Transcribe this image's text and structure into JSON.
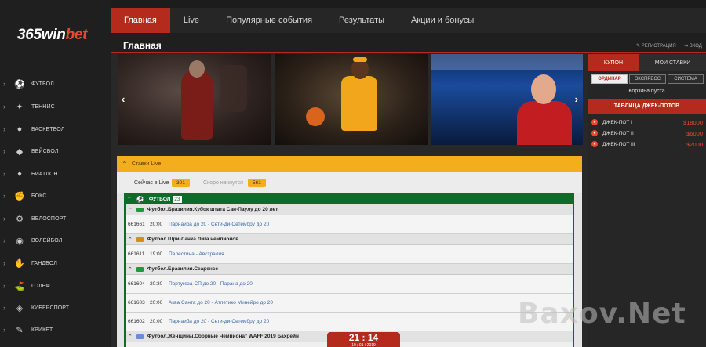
{
  "brand": {
    "logo_main": "365win",
    "logo_accent": "bet"
  },
  "topnav": [
    {
      "label": "Главная",
      "active": true
    },
    {
      "label": "Live",
      "active": false
    },
    {
      "label": "Популярные события",
      "active": false
    },
    {
      "label": "Результаты",
      "active": false
    },
    {
      "label": "Акции и бонусы",
      "active": false
    }
  ],
  "header": {
    "title": "Главная",
    "register": "РЕГИСТРАЦИЯ",
    "login": "ВХОД"
  },
  "sidebar": {
    "items": [
      {
        "label": "ФУТБОЛ",
        "icon": "football-icon"
      },
      {
        "label": "ТЕННИС",
        "icon": "tennis-icon"
      },
      {
        "label": "БАСКЕТБОЛ",
        "icon": "basketball-icon"
      },
      {
        "label": "БЕЙСБОЛ",
        "icon": "baseball-icon"
      },
      {
        "label": "БИАТЛОН",
        "icon": "biathlon-icon"
      },
      {
        "label": "БОКС",
        "icon": "boxing-icon"
      },
      {
        "label": "ВЕЛОСПОРТ",
        "icon": "cycling-icon"
      },
      {
        "label": "ВОЛЕЙБОЛ",
        "icon": "volleyball-icon"
      },
      {
        "label": "ГАНДБОЛ",
        "icon": "handball-icon"
      },
      {
        "label": "ГОЛЬФ",
        "icon": "golf-icon"
      },
      {
        "label": "КИБЕРСПОРТ",
        "icon": "esports-icon"
      },
      {
        "label": "КРИКЕТ",
        "icon": "cricket-icon"
      }
    ]
  },
  "live": {
    "title": "Ставки Live",
    "now_label": "Сейчас в Live",
    "now_count": "301",
    "soon_label": "Скоро начнутся",
    "soon_count": "561",
    "sport": {
      "name": "ФУТБОЛ",
      "count": "23"
    },
    "leagues": [
      {
        "name": "Футбол.Бразилия.Кубок штата Сан-Паулу до 20 лет",
        "flag": "brazil",
        "events": [
          {
            "id": "661661",
            "time": "20:00",
            "teams": "Парнаиба до 20 - Сети-ди-Сетембру до 20"
          }
        ]
      },
      {
        "name": "Футбол.Шри-Ланка.Лига чемпионов",
        "flag": "sri-lanka",
        "events": [
          {
            "id": "661611",
            "time": "19:00",
            "teams": "Палестина - Австралия"
          }
        ]
      },
      {
        "name": "Футбол.Бразилия.Сеаренсе",
        "flag": "brazil",
        "events": [
          {
            "id": "661604",
            "time": "20:30",
            "teams": "Португеза-СП до 20 - Парана до 20"
          },
          {
            "id": "661603",
            "time": "20:00",
            "teams": "Аква Санта до 20 - Атлетико Минейро до 20"
          },
          {
            "id": "661602",
            "time": "20:00",
            "teams": "Парнаиба до 20 - Сети-ди-Сетембру до 20"
          }
        ]
      },
      {
        "name": "Футбол.Женщины.Сборные Чемпионат WAFF 2019 Бахрейн",
        "flag": "waff",
        "events": []
      }
    ]
  },
  "clock": {
    "time": "21 : 14",
    "date": "10 / 01 / 2019"
  },
  "coupon": {
    "tab_active": "КУПОН",
    "tab_other": "МОИ СТАВКИ",
    "bet_types": [
      "ОРДИНАР",
      "ЭКСПРЕСС",
      "СИСТЕМА"
    ],
    "basket": "Корзина пуста"
  },
  "jackpots": {
    "title": "ТАБЛИЦА ДЖЕК-ПОТОВ",
    "rows": [
      {
        "name": "ДЖЕК-ПОТ I",
        "amount": "$18000"
      },
      {
        "name": "ДЖЕК-ПОТ II",
        "amount": "$6000"
      },
      {
        "name": "ДЖЕК-ПОТ III",
        "amount": "$2000"
      }
    ]
  },
  "colors": {
    "accent_red": "#b42a1c",
    "live_orange": "#f2ae1c",
    "football_green": "#0e6b2a"
  },
  "watermark": "Baxov.Net"
}
